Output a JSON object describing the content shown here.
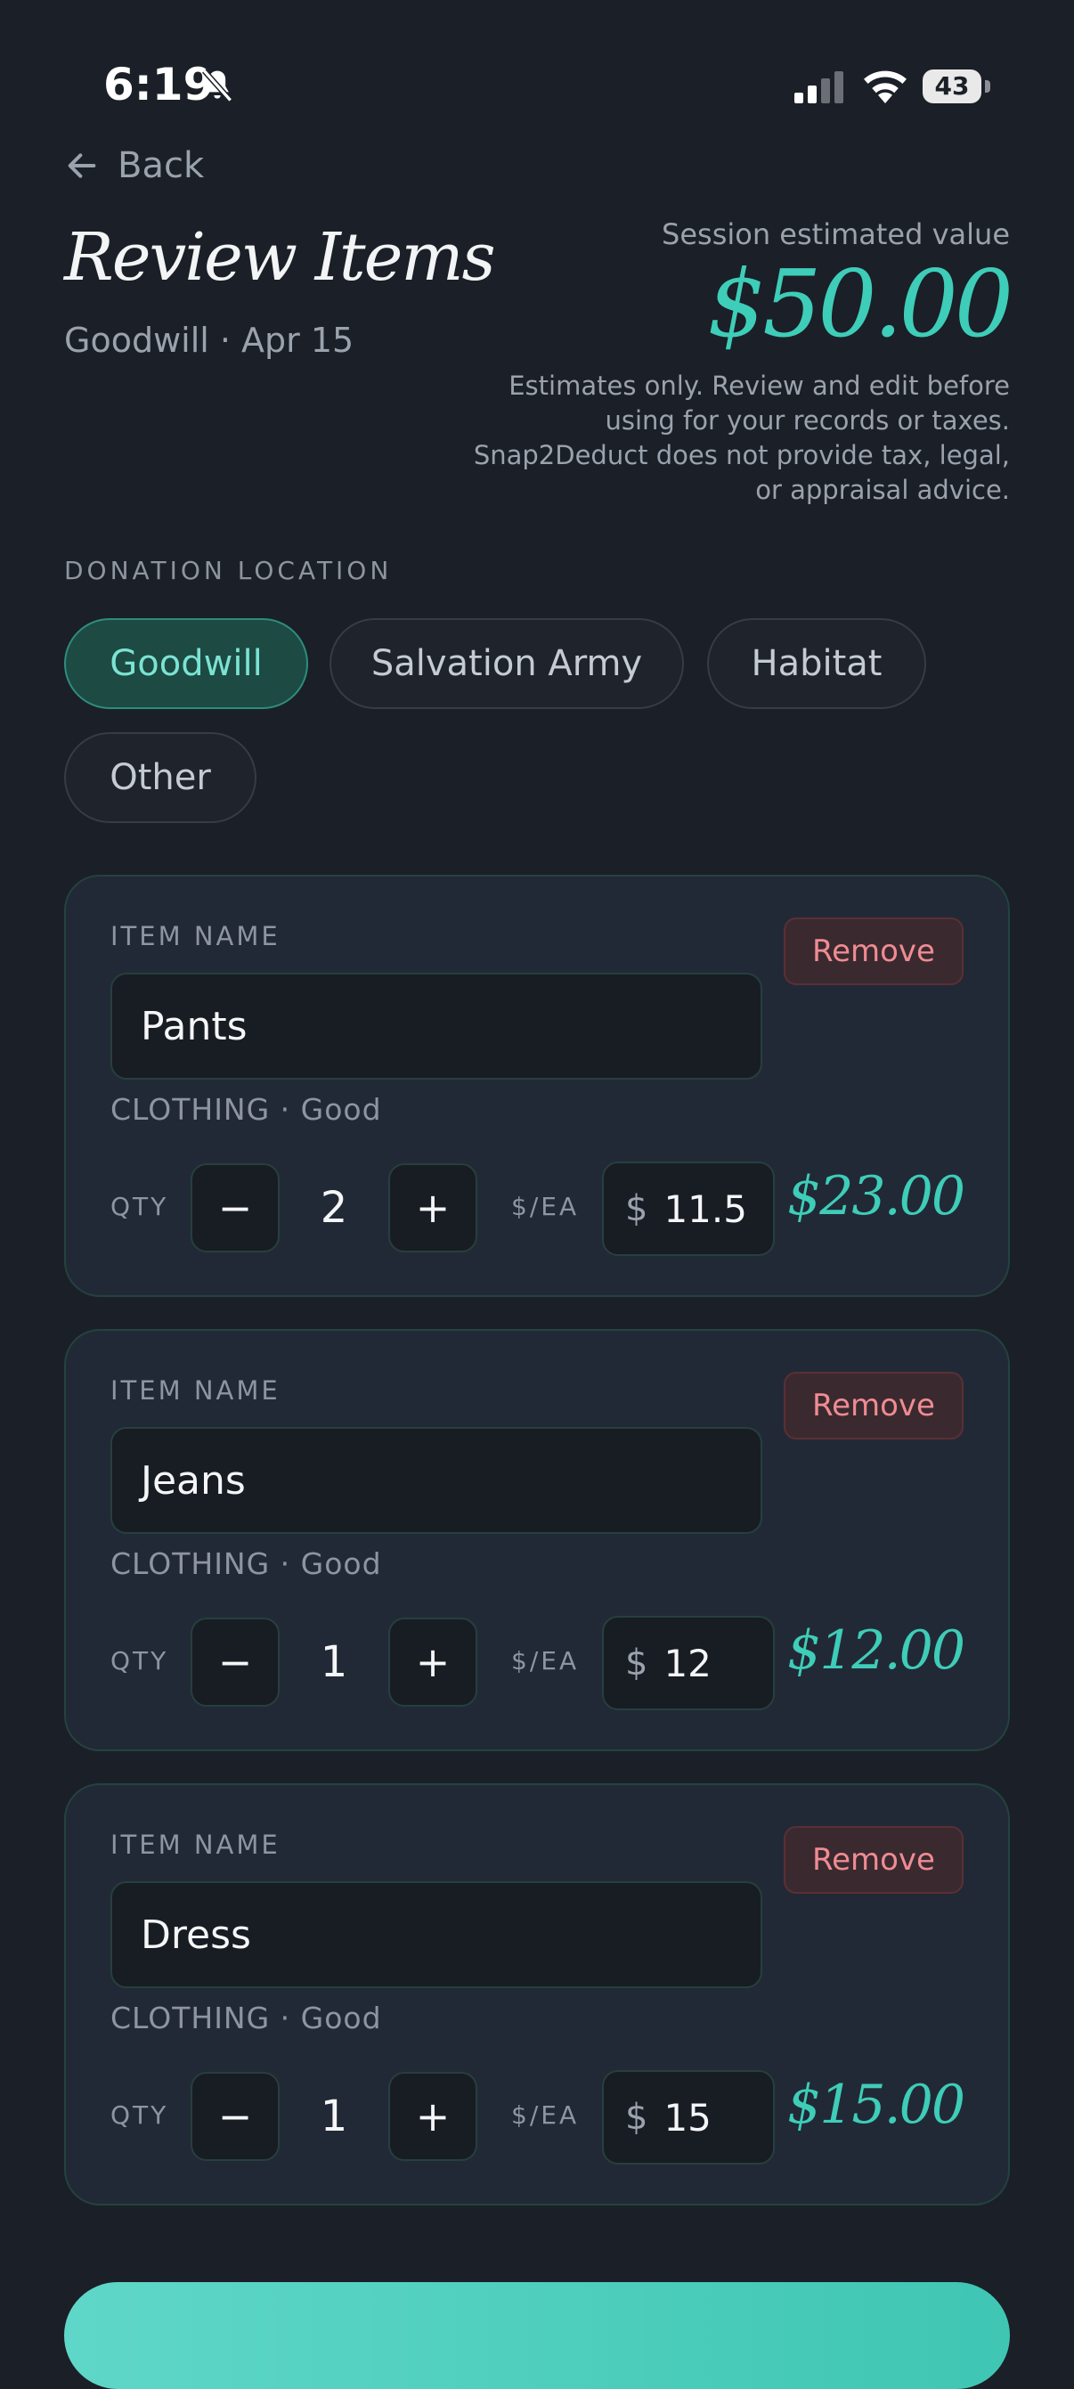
{
  "status_bar": {
    "time": "6:19",
    "battery": "43",
    "icons": [
      "bell-slash-icon",
      "cellular-signal-icon",
      "wifi-icon",
      "battery-icon"
    ]
  },
  "nav": {
    "back_label": "Back"
  },
  "header": {
    "title": "Review Items",
    "subtitle": "Goodwill · Apr 15",
    "estimate_label": "Session estimated value",
    "estimate_value": "$50.00",
    "disclaimer": "Estimates only. Review and edit before using for your records or taxes. Snap2Deduct does not provide tax, legal, or appraisal advice."
  },
  "location": {
    "label": "DONATION LOCATION",
    "options": [
      "Goodwill",
      "Salvation Army",
      "Habitat",
      "Other"
    ],
    "selected": "Goodwill"
  },
  "items": [
    {
      "name_label": "ITEM NAME",
      "name": "Pants",
      "meta": "CLOTHING · Good",
      "remove_label": "Remove",
      "qty_label": "QTY",
      "qty": "2",
      "minus": "−",
      "plus": "+",
      "ea_label": "$/EA",
      "currency": "$",
      "price": "11.5",
      "total": "$23.00"
    },
    {
      "name_label": "ITEM NAME",
      "name": "Jeans",
      "meta": "CLOTHING · Good",
      "remove_label": "Remove",
      "qty_label": "QTY",
      "qty": "1",
      "minus": "−",
      "plus": "+",
      "ea_label": "$/EA",
      "currency": "$",
      "price": "12",
      "total": "$12.00"
    },
    {
      "name_label": "ITEM NAME",
      "name": "Dress",
      "meta": "CLOTHING · Good",
      "remove_label": "Remove",
      "qty_label": "QTY",
      "qty": "1",
      "minus": "−",
      "plus": "+",
      "ea_label": "$/EA",
      "currency": "$",
      "price": "15",
      "total": "$15.00"
    }
  ],
  "colors": {
    "background": "#1b1f27",
    "card": "#222936",
    "accent": "#3ecdb8",
    "danger": "#f08b92"
  }
}
